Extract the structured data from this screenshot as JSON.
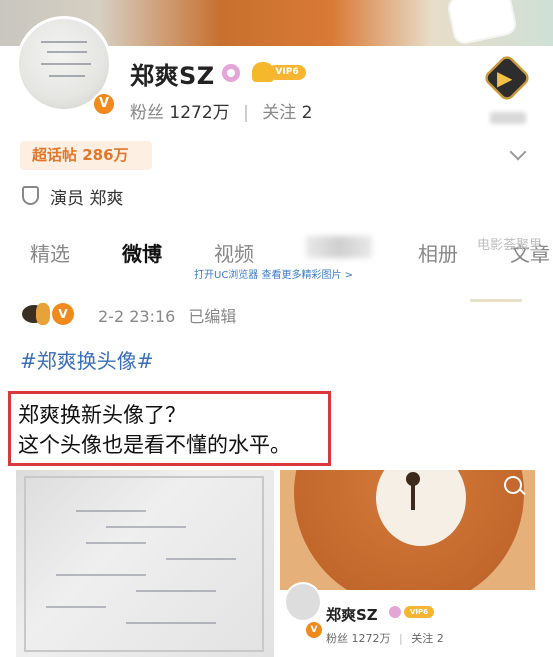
{
  "profile": {
    "name": "郑爽SZ",
    "verified_badge": "V",
    "vip_label": "VIP6",
    "fans_label": "粉丝",
    "fans_count": "1272万",
    "follow_label": "关注",
    "follow_count": "2",
    "super_topic": "超话帖 286万",
    "role": "演员 郑爽"
  },
  "tabs": [
    {
      "label": "精选"
    },
    {
      "label": "微博"
    },
    {
      "label": "视频"
    },
    {
      "label": "相册"
    },
    {
      "label": "文章"
    }
  ],
  "watermark": "电影荟聚里",
  "uc_tip": "打开UC浏览器 查看更多精彩图片 >",
  "post": {
    "timestamp": "2-2 23:16",
    "edited": "已编辑",
    "hashtag": "#郑爽换头像#",
    "line1": "郑爽换新头像了？",
    "line2": "这个头像也是看不懂的水平。"
  },
  "image_right": {
    "name": "郑爽SZ",
    "vip": "VIP6",
    "fans_label": "粉丝",
    "fans_count": "1272万",
    "follow_label": "关注",
    "follow_count": "2"
  },
  "colors": {
    "accent_orange": "#e2772b",
    "link_blue": "#3a6fb7",
    "highlight_red": "#d9383c"
  }
}
